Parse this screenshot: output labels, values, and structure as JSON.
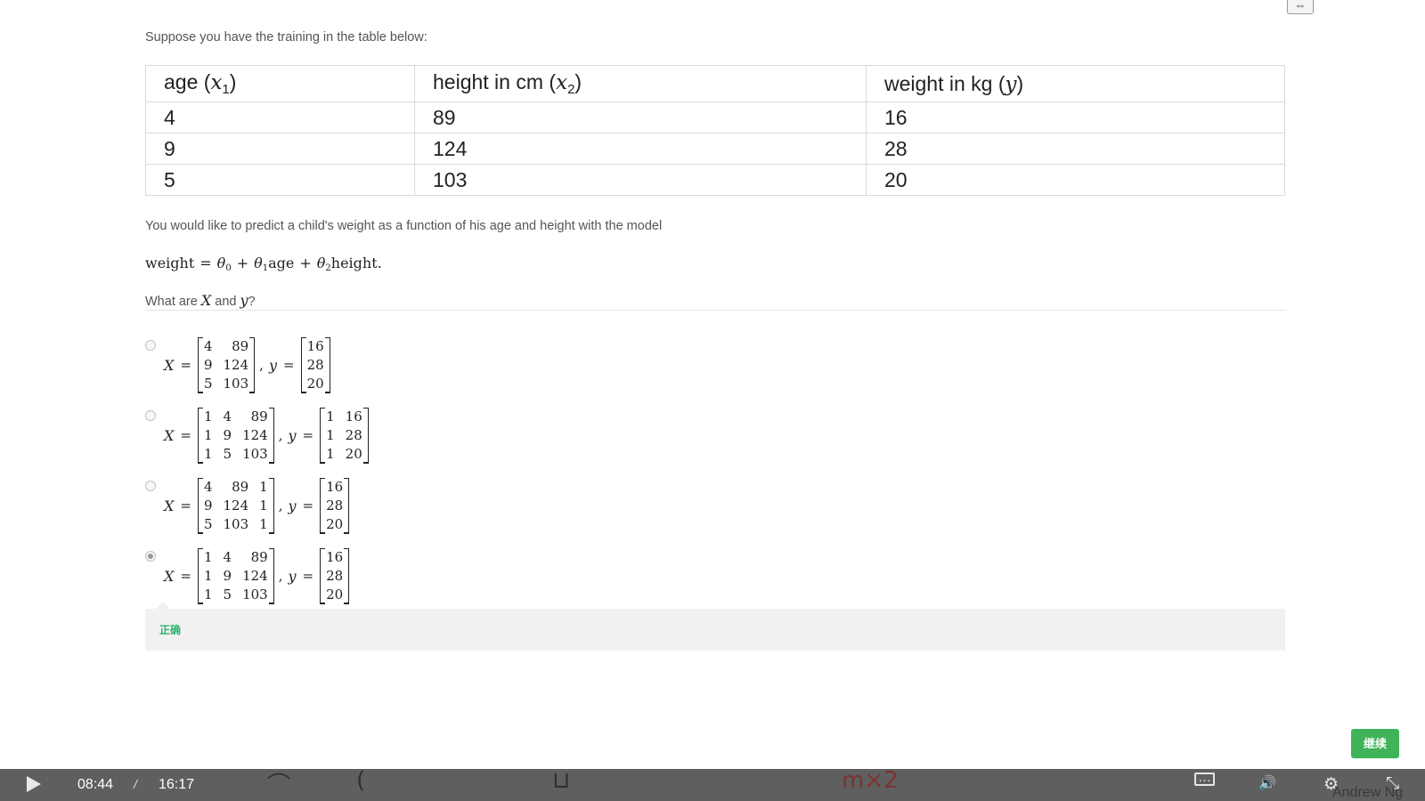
{
  "top_toggle": {
    "icon": "resize-arrows-icon",
    "glyph": "⇔"
  },
  "question": {
    "intro": "Suppose you have the training in the table below:",
    "table": {
      "headers": [
        {
          "label": "age",
          "math_var": "x",
          "math_sub": "1"
        },
        {
          "label": "height in cm",
          "math_var": "x",
          "math_sub": "2"
        },
        {
          "label": "weight in kg",
          "math_var": "y",
          "math_sub": ""
        }
      ],
      "rows": [
        [
          "4",
          "89",
          "16"
        ],
        [
          "9",
          "124",
          "28"
        ],
        [
          "5",
          "103",
          "20"
        ]
      ]
    },
    "predict_text": "You would like to predict a child's weight as a function of his age and height with the model",
    "formula": {
      "lhs": "weight",
      "theta": "θ",
      "sub0": "0",
      "sub1": "1",
      "sub2": "2",
      "var1": "age",
      "var2": "height",
      "end": "."
    },
    "prompt": {
      "before": "What are ",
      "x": "X",
      "mid": " and ",
      "y": "y",
      "after": "?"
    }
  },
  "options": [
    {
      "selected": false,
      "X_label": "X",
      "y_label": "y",
      "X": [
        [
          "4",
          "89"
        ],
        [
          "9",
          "124"
        ],
        [
          "5",
          "103"
        ]
      ],
      "y": [
        [
          "16"
        ],
        [
          "28"
        ],
        [
          "20"
        ]
      ]
    },
    {
      "selected": false,
      "X_label": "X",
      "y_label": "y",
      "X": [
        [
          "1",
          "4",
          "89"
        ],
        [
          "1",
          "9",
          "124"
        ],
        [
          "1",
          "5",
          "103"
        ]
      ],
      "y": [
        [
          "1",
          "16"
        ],
        [
          "1",
          "28"
        ],
        [
          "1",
          "20"
        ]
      ]
    },
    {
      "selected": false,
      "X_label": "X",
      "y_label": "y",
      "X": [
        [
          "4",
          "89",
          "1"
        ],
        [
          "9",
          "124",
          "1"
        ],
        [
          "5",
          "103",
          "1"
        ]
      ],
      "y": [
        [
          "16"
        ],
        [
          "28"
        ],
        [
          "20"
        ]
      ]
    },
    {
      "selected": true,
      "X_label": "X",
      "y_label": "y",
      "X": [
        [
          "1",
          "4",
          "89"
        ],
        [
          "1",
          "9",
          "124"
        ],
        [
          "1",
          "5",
          "103"
        ]
      ],
      "y": [
        [
          "16"
        ],
        [
          "28"
        ],
        [
          "20"
        ]
      ]
    }
  ],
  "feedback": {
    "text": "正确",
    "color": "#2fb36b"
  },
  "continue_button": {
    "label": "继续",
    "color": "#3fb35a"
  },
  "player": {
    "current_time": "08:44",
    "separator": "/",
    "duration": "16:17",
    "icons": {
      "play": "play-icon",
      "captions": "captions-icon",
      "volume": "volume-icon",
      "settings": "gear-icon",
      "fullscreen": "exit-fullscreen-icon"
    },
    "glyphs": {
      "captions": "…",
      "volume": "🔊",
      "settings": "⚙",
      "fullscreen": "⤡"
    },
    "background_writing": {
      "center": "m×2",
      "watermark": "Andrew Ng"
    }
  }
}
